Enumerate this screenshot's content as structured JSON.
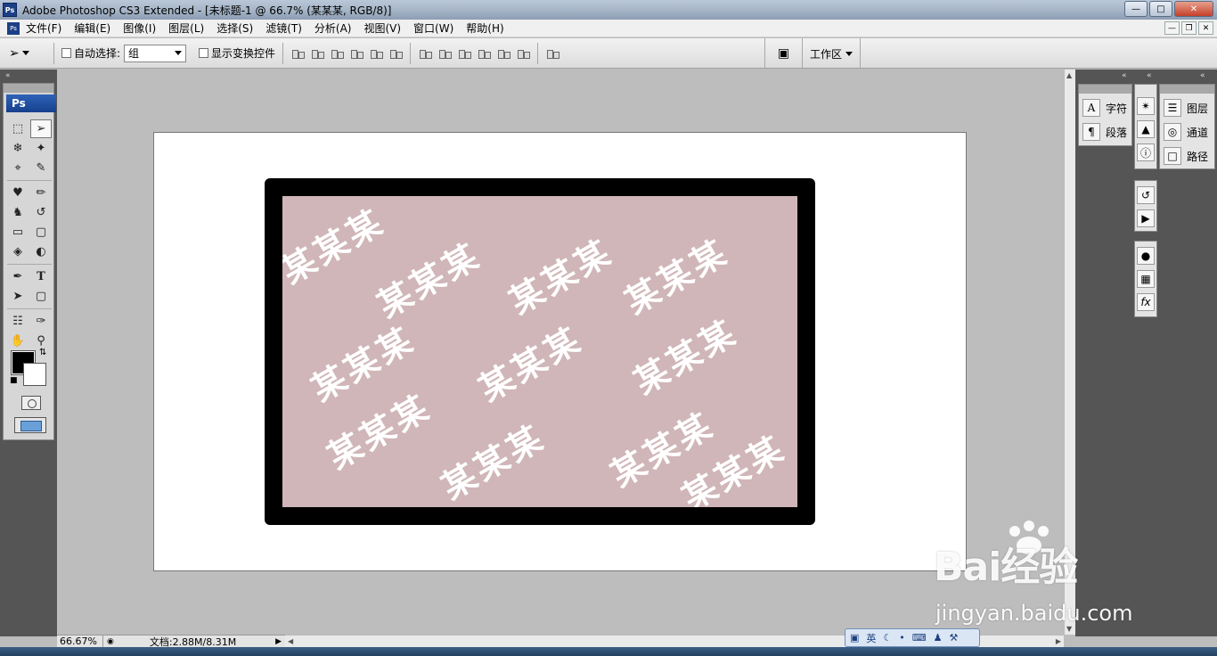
{
  "window": {
    "title": "Adobe Photoshop CS3 Extended - [未标题-1 @ 66.7% (某某某, RGB/8)]",
    "app_icon_label": "Ps"
  },
  "menu": [
    "文件(F)",
    "编辑(E)",
    "图像(I)",
    "图层(L)",
    "选择(S)",
    "滤镜(T)",
    "分析(A)",
    "视图(V)",
    "窗口(W)",
    "帮助(H)"
  ],
  "options_bar": {
    "auto_select_label": "自动选择:",
    "auto_select_value": "组",
    "show_transform_label": "显示变换控件",
    "workspace_label": "工作区"
  },
  "toolbox": {
    "logo": "Ps"
  },
  "canvas": {
    "watermark_text": "某某某",
    "pink_color": "#d0b6b8",
    "frame_color": "#000000"
  },
  "status": {
    "zoom": "66.67%",
    "doc_info": "文档:2.88M/8.31M"
  },
  "panels": {
    "character": "字符",
    "paragraph": "段落",
    "layers": "图层",
    "channels": "通道",
    "paths": "路径"
  },
  "ime": {
    "lang": "英"
  },
  "watermark_site": {
    "logo": "Bai经验",
    "url": "jingyan.baidu.com"
  }
}
